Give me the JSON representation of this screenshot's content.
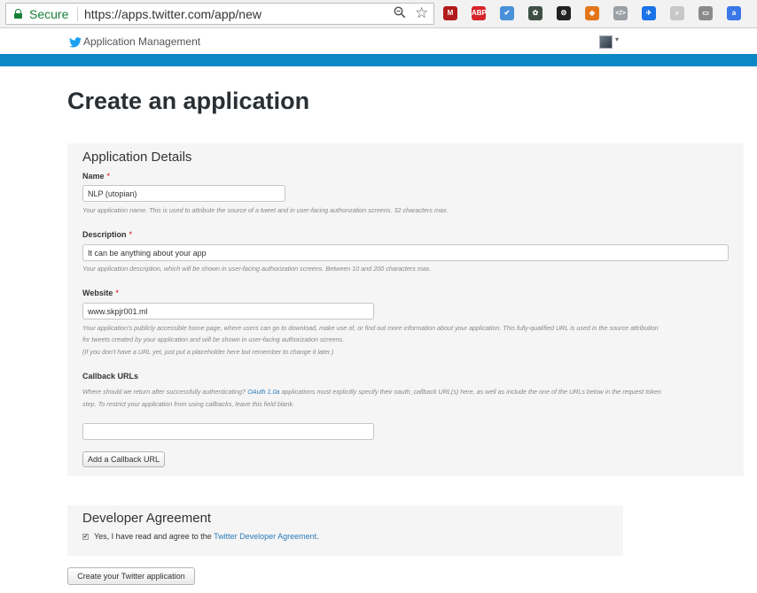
{
  "browser": {
    "secure_label": "Secure",
    "url": "https://apps.twitter.com/app/new",
    "extensions": [
      {
        "name": "mendeley-extension-icon",
        "label": "M",
        "color": "#b11b1b"
      },
      {
        "name": "adblock-plus-extension-icon",
        "label": "ABP",
        "color": "#d6242a"
      },
      {
        "name": "check-extension-icon",
        "label": "✔",
        "color": "#4a90d9"
      },
      {
        "name": "evernote-extension-icon",
        "label": "✿",
        "color": "#3f4f45"
      },
      {
        "name": "gear-extension-icon",
        "label": "⚙",
        "color": "#222222"
      },
      {
        "name": "metamask-extension-icon",
        "label": "◆",
        "color": "#e2761b"
      },
      {
        "name": "code-extension-icon",
        "label": "</>",
        "color": "#9aa0a6"
      },
      {
        "name": "plane-extension-icon",
        "label": "✈",
        "color": "#1a73e8"
      },
      {
        "name": "search-extension-icon",
        "label": "⌕",
        "color": "#c7c7c7"
      },
      {
        "name": "window-extension-icon",
        "label": "▭",
        "color": "#8a8a8a"
      },
      {
        "name": "translate-extension-icon",
        "label": "a",
        "color": "#3b78e7"
      }
    ]
  },
  "header": {
    "app_title": "Application Management",
    "caret": "▾"
  },
  "page_title": "Create an application",
  "details": {
    "heading": "Application Details",
    "required_mark": "*",
    "name": {
      "label": "Name",
      "value": "NLP (utopian)",
      "help": "Your application name. This is used to attribute the source of a tweet and in user-facing authorization screens. 32 characters max."
    },
    "description": {
      "label": "Description",
      "value": "It can be anything about your app",
      "help": "Your application description, which will be shown in user-facing authorization screens. Between 10 and 200 characters max."
    },
    "website": {
      "label": "Website",
      "value": "www.skpjr001.ml",
      "help_line1": "Your application's publicly accessible home page, where users can go to download, make use of, or find out more information about your application. This fully-qualified URL is used in the source attribution",
      "help_line2": "for tweets created by your application and will be shown in user-facing authorization screens.",
      "help_line3": "(If you don't have a URL yet, just put a placeholder here but remember to change it later.)"
    },
    "callback": {
      "label": "Callback URLs",
      "help_pre": "Where should we return after successfully authenticating?",
      "help_link": "OAuth 1.0a",
      "help_post": "applications must explicitly specify their oauth_callback URL(s) here, as well as include the one of the URLs below in the request token",
      "help_line2": "step. To restrict your application from using callbacks, leave this field blank.",
      "value": "",
      "add_button": "Add a Callback URL"
    }
  },
  "agreement": {
    "heading": "Developer Agreement",
    "check_mark": "✔",
    "text_pre": "Yes, I have read and agree to the",
    "link": "Twitter Developer Agreement",
    "text_post": "."
  },
  "submit_button": "Create your Twitter application"
}
